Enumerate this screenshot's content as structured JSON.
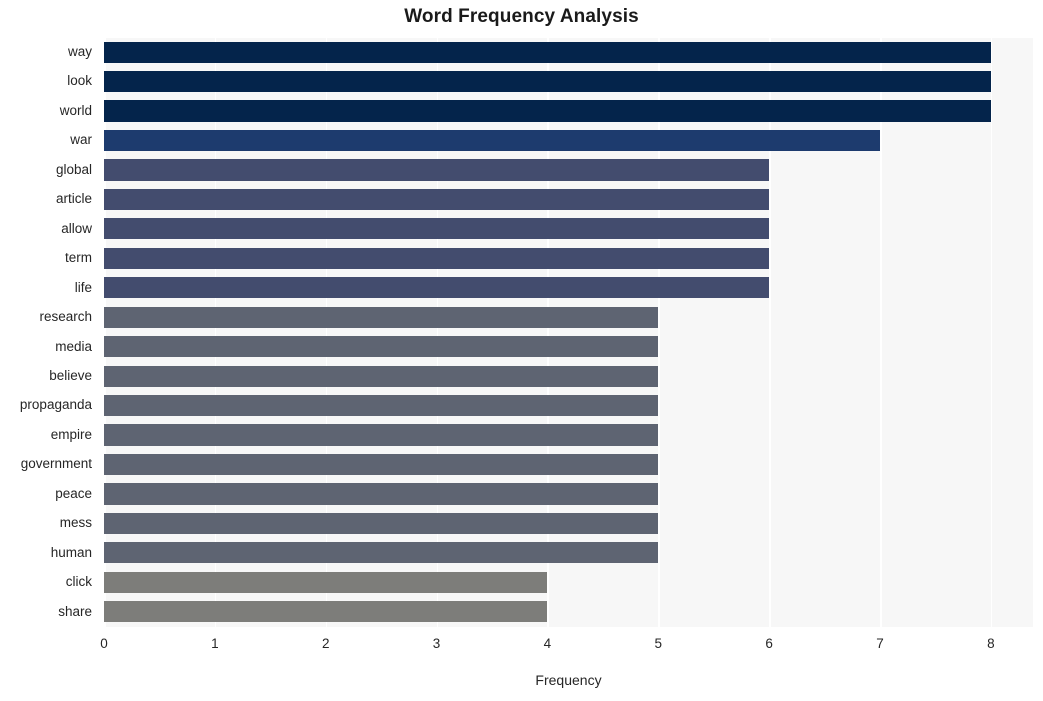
{
  "chart_data": {
    "type": "bar",
    "orientation": "horizontal",
    "title": "Word Frequency Analysis",
    "xlabel": "Frequency",
    "ylabel": "",
    "xlim": [
      0,
      8.38
    ],
    "ylim": [
      0,
      20
    ],
    "xticks": [
      0,
      1,
      2,
      3,
      4,
      5,
      6,
      7,
      8
    ],
    "xtick_labels": [
      "0",
      "1",
      "2",
      "3",
      "4",
      "5",
      "6",
      "7",
      "8"
    ],
    "grid": "vertical-white-on-light-gray",
    "legend": "none",
    "categories": [
      "way",
      "look",
      "world",
      "war",
      "global",
      "article",
      "allow",
      "term",
      "life",
      "research",
      "media",
      "believe",
      "propaganda",
      "empire",
      "government",
      "peace",
      "mess",
      "human",
      "click",
      "share"
    ],
    "values": [
      8,
      8,
      8,
      7,
      6,
      6,
      6,
      6,
      6,
      5,
      5,
      5,
      5,
      5,
      5,
      5,
      5,
      5,
      4,
      4
    ],
    "bar_colors": [
      "#04244b",
      "#04244b",
      "#04244b",
      "#1d3b6e",
      "#434c6e",
      "#434c6e",
      "#434c6e",
      "#434c6e",
      "#434c6e",
      "#5e6472",
      "#5e6472",
      "#5e6472",
      "#5e6472",
      "#5e6472",
      "#5e6472",
      "#5e6472",
      "#5e6472",
      "#5e6472",
      "#7d7d7a",
      "#7d7d7a"
    ],
    "plot_background": "#f7f7f7",
    "figure_background": "#ffffff",
    "gridline_color": "#ffffff"
  }
}
